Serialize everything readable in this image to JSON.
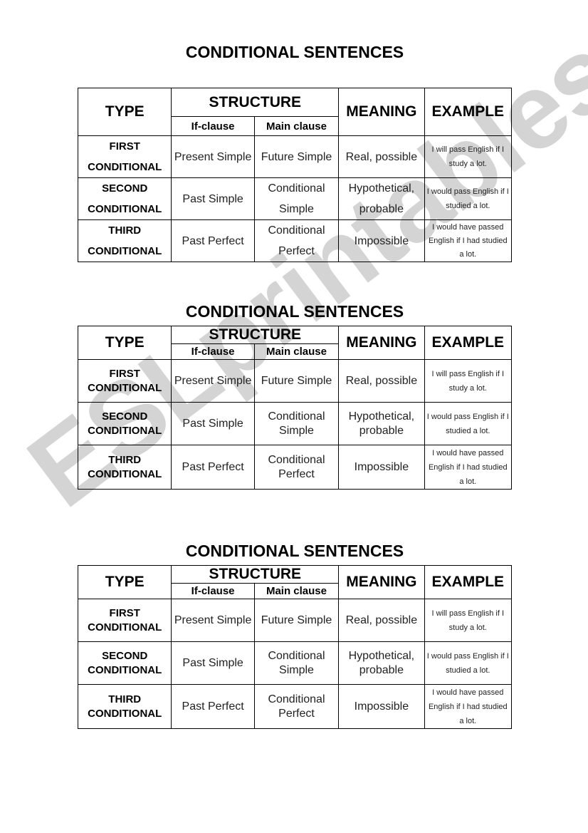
{
  "watermark": "ESLprintables.com",
  "sections": [
    {
      "title": "CONDITIONAL SENTENCES",
      "headers": {
        "type": "TYPE",
        "structure": "STRUCTURE",
        "if_clause": "If-clause",
        "main_clause": "Main clause",
        "meaning": "MEANING",
        "example": "EXAMPLE"
      },
      "rows": [
        {
          "type_line1": "FIRST",
          "type_line2": "CONDITIONAL",
          "if_clause": "Present Simple",
          "main_clause": "Future Simple",
          "meaning": "Real, possible",
          "example": "I will pass English if I study a lot."
        },
        {
          "type_line1": "SECOND",
          "type_line2": "CONDITIONAL",
          "if_clause": "Past Simple",
          "main_clause": "Conditional Simple",
          "meaning": "Hypothetical, probable",
          "example": "I would pass English if I studied a lot."
        },
        {
          "type_line1": "THIRD",
          "type_line2": "CONDITIONAL",
          "if_clause": "Past Perfect",
          "main_clause": "Conditional Perfect",
          "meaning": "Impossible",
          "example": "I would have passed English if I had studied a lot."
        }
      ]
    },
    {
      "title": "CONDITIONAL SENTENCES",
      "headers": {
        "type": "TYPE",
        "structure": "STRUCTURE",
        "if_clause": "If-clause",
        "main_clause": "Main clause",
        "meaning": "MEANING",
        "example": "EXAMPLE"
      },
      "rows": [
        {
          "type_line1": "FIRST",
          "type_line2": "CONDITIONAL",
          "if_clause": "Present Simple",
          "main_clause": "Future Simple",
          "meaning": "Real, possible",
          "example": "I will pass English if I study a lot."
        },
        {
          "type_line1": "SECOND",
          "type_line2": "CONDITIONAL",
          "if_clause": "Past Simple",
          "main_clause": "Conditional Simple",
          "meaning": "Hypothetical, probable",
          "example": "I would pass English if I studied a lot."
        },
        {
          "type_line1": "THIRD",
          "type_line2": "CONDITIONAL",
          "if_clause": "Past Perfect",
          "main_clause": "Conditional Perfect",
          "meaning": "Impossible",
          "example": "I would have passed English if I had studied a lot."
        }
      ]
    },
    {
      "title": "CONDITIONAL SENTENCES",
      "headers": {
        "type": "TYPE",
        "structure": "STRUCTURE",
        "if_clause": "If-clause",
        "main_clause": "Main clause",
        "meaning": "MEANING",
        "example": "EXAMPLE"
      },
      "rows": [
        {
          "type_line1": "FIRST",
          "type_line2": "CONDITIONAL",
          "if_clause": "Present Simple",
          "main_clause": "Future Simple",
          "meaning": "Real, possible",
          "example": "I will pass English if I study a lot."
        },
        {
          "type_line1": "SECOND",
          "type_line2": "CONDITIONAL",
          "if_clause": "Past Simple",
          "main_clause": "Conditional Simple",
          "meaning": "Hypothetical, probable",
          "example": "I would pass English if I studied a lot."
        },
        {
          "type_line1": "THIRD",
          "type_line2": "CONDITIONAL",
          "if_clause": "Past Perfect",
          "main_clause": "Conditional Perfect",
          "meaning": "Impossible",
          "example": "I would have passed English if I had studied a lot."
        }
      ]
    }
  ]
}
